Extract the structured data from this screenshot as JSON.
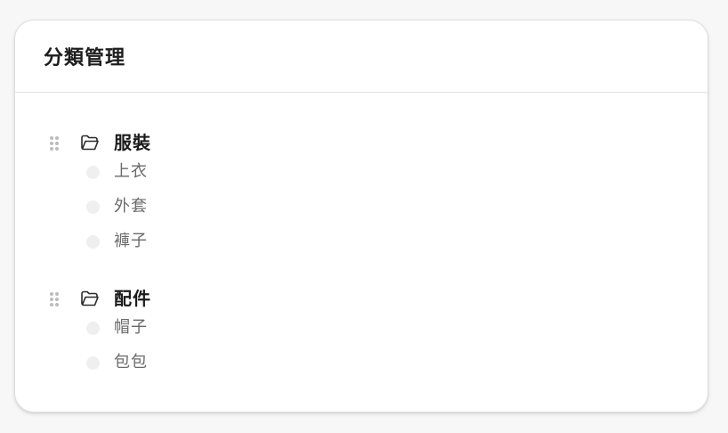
{
  "card": {
    "title": "分類管理"
  },
  "categories": [
    {
      "name": "服裝",
      "children": [
        "上衣",
        "外套",
        "褲子"
      ]
    },
    {
      "name": "配件",
      "children": [
        "帽子",
        "包包"
      ]
    }
  ],
  "icons": {
    "drag": "drag-handle-icon",
    "folder": "folder-open-icon",
    "bullet": "bullet-dot"
  },
  "colors": {
    "title": "#1d1d1d",
    "group_label": "#1b1b1b",
    "child_label": "#6a6a6a",
    "bullet": "#efefef",
    "handle": "#bcbcbc"
  }
}
